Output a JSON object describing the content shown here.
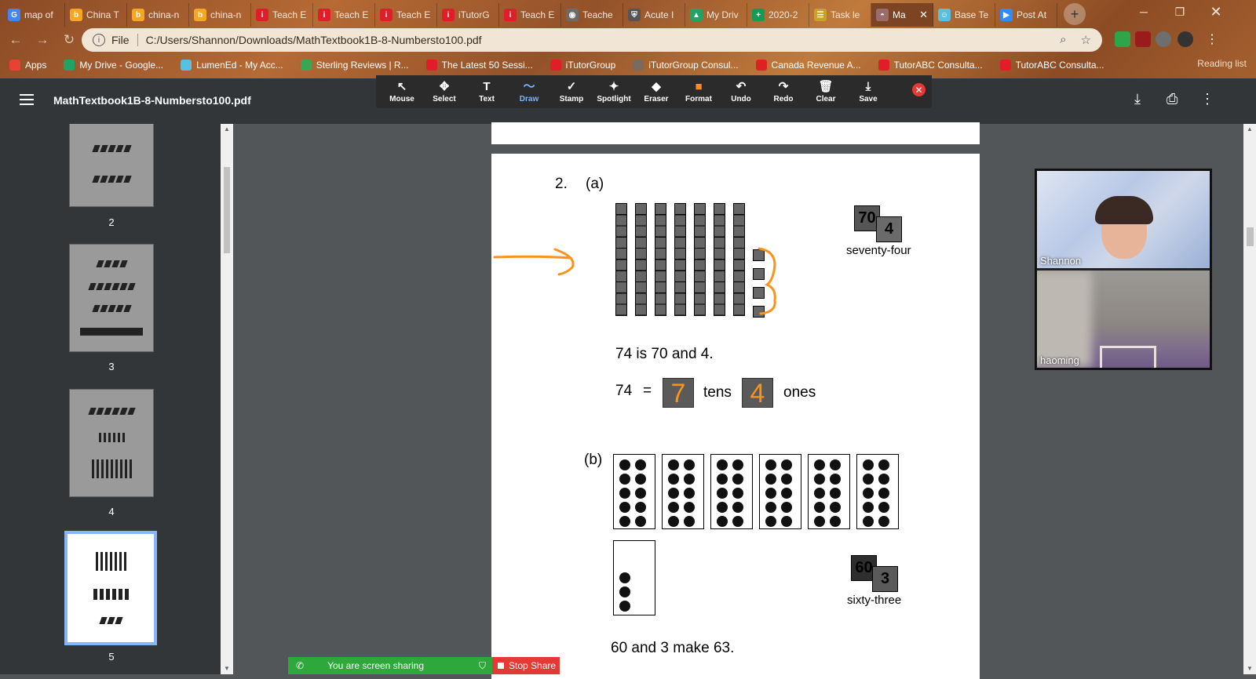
{
  "browser": {
    "tabs": [
      {
        "title": "map of",
        "icon_letter": "G",
        "icon_color": "#4285f4"
      },
      {
        "title": "China T",
        "icon_letter": "b",
        "icon_color": "#f5a623"
      },
      {
        "title": "china-n",
        "icon_letter": "b",
        "icon_color": "#f5a623"
      },
      {
        "title": "china-n",
        "icon_letter": "b",
        "icon_color": "#f5a623"
      },
      {
        "title": "Teach E",
        "icon_letter": "i",
        "icon_color": "#e11d2a"
      },
      {
        "title": "Teach E",
        "icon_letter": "i",
        "icon_color": "#e11d2a"
      },
      {
        "title": "Teach E",
        "icon_letter": "i",
        "icon_color": "#e11d2a"
      },
      {
        "title": "iTutorG",
        "icon_letter": "i",
        "icon_color": "#e11d2a"
      },
      {
        "title": "Teach E",
        "icon_letter": "i",
        "icon_color": "#e11d2a"
      },
      {
        "title": "Teache",
        "icon_letter": "◉",
        "icon_color": "#6b6b6b"
      },
      {
        "title": "Acute I",
        "icon_letter": "⛨",
        "icon_color": "#555555"
      },
      {
        "title": "My Driv",
        "icon_letter": "▲",
        "icon_color": "#1fa463"
      },
      {
        "title": "2020-2",
        "icon_letter": "+",
        "icon_color": "#0f9d58"
      },
      {
        "title": "Task le",
        "icon_letter": "☰",
        "icon_color": "#c9a227"
      },
      {
        "title": "Ma",
        "icon_letter": "◓",
        "icon_color": "#9c6b6b",
        "active": true
      },
      {
        "title": "Base Te",
        "icon_letter": "☺",
        "icon_color": "#5bc0de"
      },
      {
        "title": "Post At",
        "icon_letter": "▶",
        "icon_color": "#2d8cff"
      }
    ],
    "new_tab": "+",
    "address": {
      "scheme_label": "File",
      "url": "C:/Users/Shannon/Downloads/MathTextbook1B-8-Numbersto100.pdf"
    },
    "bookmarks": [
      {
        "title": "Apps",
        "icon_color": "#e94235"
      },
      {
        "title": "My Drive - Google...",
        "icon_color": "#1fa463"
      },
      {
        "title": "LumenEd - My Acc...",
        "icon_color": "#5bc0de"
      },
      {
        "title": "Sterling Reviews | R...",
        "icon_color": "#3aa655"
      },
      {
        "title": "The Latest 50 Sessi...",
        "icon_color": "#e11d2a"
      },
      {
        "title": "iTutorGroup",
        "icon_color": "#e11d2a"
      },
      {
        "title": "iTutorGroup Consul...",
        "icon_color": "#7a6b5c"
      },
      {
        "title": "Canada Revenue A...",
        "icon_color": "#d22"
      },
      {
        "title": "TutorABC Consulta...",
        "icon_color": "#e11d2a"
      },
      {
        "title": "TutorABC Consulta...",
        "icon_color": "#e11d2a"
      }
    ],
    "reading_list": "Reading list"
  },
  "pdf": {
    "filename": "MathTextbook1B-8-Numbersto100.pdf"
  },
  "annotate": {
    "tools": [
      {
        "label": "Mouse",
        "icon": "↖"
      },
      {
        "label": "Select",
        "icon": "✥"
      },
      {
        "label": "Text",
        "icon": "T"
      },
      {
        "label": "Draw",
        "icon": "〜",
        "active": true
      },
      {
        "label": "Stamp",
        "icon": "✓"
      },
      {
        "label": "Spotlight",
        "icon": "✦"
      },
      {
        "label": "Eraser",
        "icon": "◆"
      },
      {
        "label": "Format",
        "icon": "■"
      },
      {
        "label": "Undo",
        "icon": "↶"
      },
      {
        "label": "Redo",
        "icon": "↷"
      },
      {
        "label": "Clear",
        "icon": "🗑"
      },
      {
        "label": "Save",
        "icon": "⤓"
      }
    ],
    "format_color": "#ff8c1a"
  },
  "thumbnails": [
    {
      "page": "2"
    },
    {
      "page": "3"
    },
    {
      "page": "4"
    },
    {
      "page": "5",
      "selected": true
    }
  ],
  "content": {
    "q_number": "2.",
    "part_a": "(a)",
    "card_a_tens": "70",
    "card_a_ones": "4",
    "word_a": "seventy-four",
    "sentence_a1": "74 is 70 and 4.",
    "eq_a_left": "74",
    "eq_a_equals": "=",
    "tens_value": "7",
    "tens_label": "tens",
    "ones_value": "4",
    "ones_label": "ones",
    "part_b": "(b)",
    "card_b_tens": "60",
    "card_b_ones": "3",
    "word_b": "sixty-three",
    "sentence_b1": "60 and 3 make 63.",
    "annotation_color": "#f7941d"
  },
  "video": {
    "participants": [
      {
        "name": "Shannon"
      },
      {
        "name": "haoming"
      }
    ]
  },
  "share": {
    "status": "You are screen sharing",
    "stop_label": "Stop Share"
  }
}
